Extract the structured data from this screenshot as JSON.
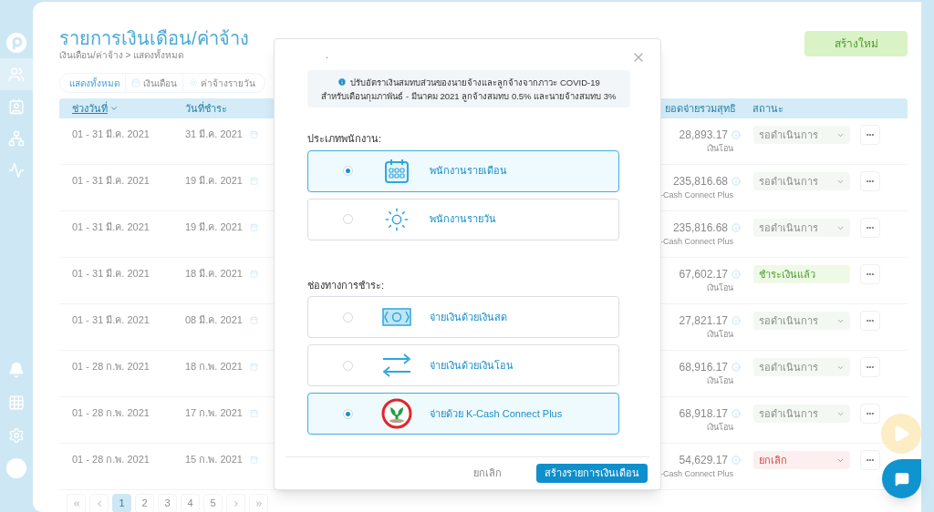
{
  "sidebar": {
    "items": [
      {
        "kind": "logo",
        "selected": false
      },
      {
        "kind": "people",
        "selected": true
      },
      {
        "kind": "badge",
        "selected": false
      },
      {
        "kind": "org",
        "selected": false
      },
      {
        "kind": "monitor",
        "selected": false
      }
    ],
    "bottom_items": [
      {
        "kind": "bell"
      },
      {
        "kind": "grid"
      },
      {
        "kind": "gear"
      },
      {
        "kind": "avatar"
      }
    ]
  },
  "page": {
    "title": "รายการเงินเดือน/ค่าจ้าง",
    "breadcrumb": "เงินเดือน/ค่าจ้าง > แสดงทั้งหมด",
    "create_button": "สร้างใหม่"
  },
  "tabs": [
    {
      "label": "แสดงทั้งหมด",
      "kind": "all",
      "selected": true
    },
    {
      "label": "เงินเดือน",
      "kind": "monthly",
      "selected": false
    },
    {
      "label": "ค่าจ้างรายวัน",
      "kind": "daily",
      "selected": false
    }
  ],
  "table": {
    "columns": [
      "ช่วงวันที่",
      "วันที่ชำระ",
      "ยอดจ่ายรวมสุทธิ",
      "สถานะ"
    ],
    "rows": [
      {
        "period": "01 - 31 มี.ค. 2021",
        "pay_date": "31 มี.ค. 2021",
        "amount": "28,893.17",
        "method": "เงินโอน",
        "status": "รอดำเนินการ",
        "kind": "pending",
        "more": "•••"
      },
      {
        "period": "01 - 31 มี.ค. 2021",
        "pay_date": "19 มี.ค. 2021",
        "amount": "235,816.68",
        "method": "-Cash Connect Plus",
        "status": "รอดำเนินการ",
        "kind": "pending",
        "more": "•••"
      },
      {
        "period": "01 - 31 มี.ค. 2021",
        "pay_date": "19 มี.ค. 2021",
        "amount": "235,816.68",
        "method": "-Cash Connect Plus",
        "status": "รอดำเนินการ",
        "kind": "pending",
        "more": "•••"
      },
      {
        "period": "01 - 31 มี.ค. 2021",
        "pay_date": "18 มี.ค. 2021",
        "amount": "67,602.17",
        "method": "เงินโอน",
        "status": "ชำระเงินแล้ว",
        "kind": "paid",
        "more": "•••"
      },
      {
        "period": "01 - 31 มี.ค. 2021",
        "pay_date": "08 มี.ค. 2021",
        "amount": "27,821.17",
        "method": "เงินโอน",
        "status": "รอดำเนินการ",
        "kind": "pending",
        "more": "•••"
      },
      {
        "period": "01 - 28 ก.พ. 2021",
        "pay_date": "18 ก.พ. 2021",
        "amount": "68,916.17",
        "method": "เงินโอน",
        "status": "รอดำเนินการ",
        "kind": "pending",
        "more": "•••"
      },
      {
        "period": "01 - 28 ก.พ. 2021",
        "pay_date": "17 ก.พ. 2021",
        "amount": "68,918.17",
        "method": "เงินโอน",
        "status": "รอดำเนินการ",
        "kind": "pending",
        "more": "•••"
      },
      {
        "period": "01 - 28 ก.พ. 2021",
        "pay_date": "15 ก.พ. 2021",
        "amount": "54,629.17",
        "method": "-Cash Connect Plus",
        "status": "ยกเลิก",
        "kind": "cancelled",
        "more": "•••"
      }
    ]
  },
  "pagination": [
    {
      "kind": "first"
    },
    {
      "kind": "prev"
    },
    {
      "kind": "page",
      "label": "1",
      "selected": true
    },
    {
      "kind": "page",
      "label": "2",
      "selected": false
    },
    {
      "kind": "page",
      "label": "3",
      "selected": false
    },
    {
      "kind": "page",
      "label": "4",
      "selected": false
    },
    {
      "kind": "page",
      "label": "5",
      "selected": false
    },
    {
      "kind": "next"
    },
    {
      "kind": "last"
    }
  ],
  "dialog": {
    "top_mark": ".",
    "notice": [
      "ปรับอัตราเงินสมทบส่วนของนายจ้างและลูกจ้างจากภาวะ COVID-19",
      "สำหรับเดือนกุมภาพันธ์ - มีนาคม 2021 ลูกจ้างสมทบ 0.5% และนายจ้างสมทบ 3%"
    ],
    "sections": [
      {
        "label": "ประเภทพนักงาน:",
        "options": [
          {
            "label": "พนักงานรายเดือน",
            "kind": "calendar",
            "selected": true
          },
          {
            "label": "พนักงานรายวัน",
            "kind": "sun",
            "selected": false
          }
        ]
      },
      {
        "label": "ช่องทางการชำระ:",
        "options": [
          {
            "label": "จ่ายเงินด้วยเงินสด",
            "kind": "cash",
            "selected": false
          },
          {
            "label": "จ่ายเงินด้วยเงินโอน",
            "kind": "transfer",
            "selected": false
          },
          {
            "label": "จ่ายด้วย K-Cash Connect Plus",
            "kind": "bank",
            "selected": true
          }
        ]
      }
    ],
    "cancel_button": "ยกเลิก",
    "confirm_button": "สร้างรายการเงินเดือน"
  }
}
